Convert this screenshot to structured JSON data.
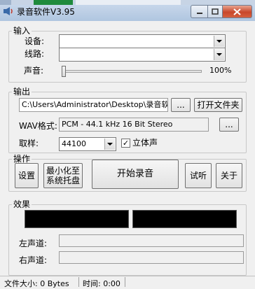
{
  "window": {
    "title": "录音软件V3.95",
    "icon": "audio-speaker-icon"
  },
  "input_group": {
    "title": "输入",
    "device_label": "设备:",
    "device_value": "",
    "line_label": "线路:",
    "line_value": "",
    "volume_label": "声音:",
    "volume_value": "100%",
    "volume_level": 0
  },
  "output_group": {
    "title": "输出",
    "path_value": "C:\\Users\\Administrator\\Desktop\\录音软件:",
    "browse_label": "...",
    "open_folder_label": "打开文件夹",
    "wav_label": "WAV格式:",
    "wav_value": "PCM - 44.1 kHz 16 Bit Stereo",
    "wav_browse_label": "...",
    "sample_label": "取样:",
    "sample_value": "44100",
    "stereo_label": "立体声",
    "stereo_checked": true,
    "stereo_check_glyph": "✓"
  },
  "ops_group": {
    "title": "操作",
    "settings_label": "设置",
    "minimize_label_1": "最小化至",
    "minimize_label_2": "系统托盘",
    "record_label": "开始录音",
    "listen_label": "试听",
    "about_label": "关于"
  },
  "effects_group": {
    "title": "效果",
    "left_channel_label": "左声道:",
    "right_channel_label": "右声道:",
    "left_level": 0,
    "right_level": 0
  },
  "status": {
    "file_size": "文件大小: 0 Bytes",
    "time": "时间: 0:00"
  },
  "colors": {
    "close_button": "#c8472b",
    "meter_background": "#000000",
    "window_face": "#f0f0f0"
  }
}
